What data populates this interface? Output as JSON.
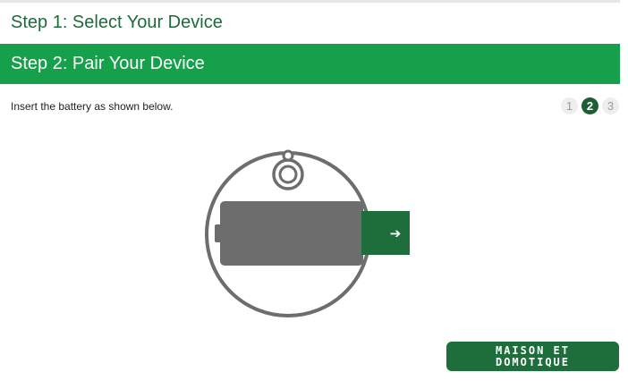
{
  "wizard": {
    "step1_title": "Step 1: Select Your Device",
    "step2_title": "Step 2: Pair Your Device",
    "instruction": "Insert the battery as shown below.",
    "steps": [
      "1",
      "2",
      "3"
    ],
    "active_step": 2
  },
  "illustration": {
    "arrow": "➔"
  },
  "watermark": {
    "line1": "MAISON ET",
    "line2": "DOMOTIQUE"
  },
  "colors": {
    "brand_green": "#16a04b",
    "dark_green": "#1d5e36",
    "battery_gray": "#6d6d6d"
  }
}
